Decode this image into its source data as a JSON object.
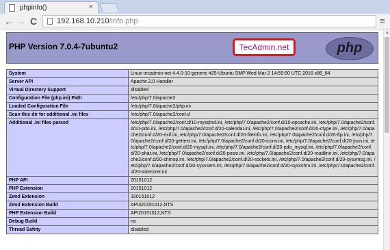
{
  "browser": {
    "tab_title": "phpinfo()",
    "tab_close": "×",
    "back": "←",
    "forward": "→",
    "reload": "C",
    "url_host": "192.168.10.210",
    "url_path": "/info.php",
    "menu": "≡"
  },
  "header": {
    "version": "PHP Version 7.0.4-7ubuntu2",
    "badge": "TecAdmin.net",
    "logo": "php"
  },
  "rows": [
    {
      "key": "System",
      "value": "Linux tecadmin-net 4.4.0-10-generic #25-Ubuntu SMP Wed Mar 2 14:55:50 UTC 2016 x86_64"
    },
    {
      "key": "Server API",
      "value": "Apache 2.0 Handler"
    },
    {
      "key": "Virtual Directory Support",
      "value": "disabled"
    },
    {
      "key": "Configuration File (php.ini) Path",
      "value": "/etc/php/7.0/apache2"
    },
    {
      "key": "Loaded Configuration File",
      "value": "/etc/php/7.0/apache2/php.ini"
    },
    {
      "key": "Scan this dir for additional .ini files",
      "value": "/etc/php/7.0/apache2/conf.d"
    },
    {
      "key": "Additional .ini files parsed",
      "value": "/etc/php/7.0/apache2/conf.d/10-mysqlnd.ini, /etc/php/7.0/apache2/conf.d/10-opcache.ini, /etc/php/7.0/apache2/conf.d/10-pdo.ini, /etc/php/7.0/apache2/conf.d/20-calendar.ini, /etc/php/7.0/apache2/conf.d/20-ctype.ini, /etc/php/7.0/apache2/conf.d/20-exif.ini, /etc/php/7.0/apache2/conf.d/20-fileinfo.ini, /etc/php/7.0/apache2/conf.d/20-ftp.ini, /etc/php/7.0/apache2/conf.d/20-gettext.ini, /etc/php/7.0/apache2/conf.d/20-iconv.ini, /etc/php/7.0/apache2/conf.d/20-json.ini, /etc/php/7.0/apache2/conf.d/20-mysqli.ini, /etc/php/7.0/apache2/conf.d/20-pdo_mysql.ini, /etc/php/7.0/apache2/conf.d/20-phar.ini, /etc/php/7.0/apache2/conf.d/20-posix.ini, /etc/php/7.0/apache2/conf.d/20-readline.ini, /etc/php/7.0/apache2/conf.d/20-shmop.ini, /etc/php/7.0/apache2/conf.d/20-sockets.ini, /etc/php/7.0/apache2/conf.d/20-sysvmsg.ini, /etc/php/7.0/apache2/conf.d/20-sysvsem.ini, /etc/php/7.0/apache2/conf.d/20-sysvshm.ini, /etc/php/7.0/apache2/conf.d/20-tokenizer.ini"
    },
    {
      "key": "PHP API",
      "value": "20151012"
    },
    {
      "key": "PHP Extension",
      "value": "20151012"
    },
    {
      "key": "Zend Extension",
      "value": "320151012"
    },
    {
      "key": "Zend Extension Build",
      "value": "API320151012,NTS"
    },
    {
      "key": "PHP Extension Build",
      "value": "API20151012,NTS"
    },
    {
      "key": "Debug Build",
      "value": "no"
    },
    {
      "key": "Thread Safety",
      "value": "disabled"
    }
  ],
  "colors": {
    "header_bg": "#9999cc",
    "key_bg": "#ccccff",
    "value_bg": "#dddddd",
    "badge_border": "#d01c1c",
    "badge_text": "#b0127a"
  }
}
